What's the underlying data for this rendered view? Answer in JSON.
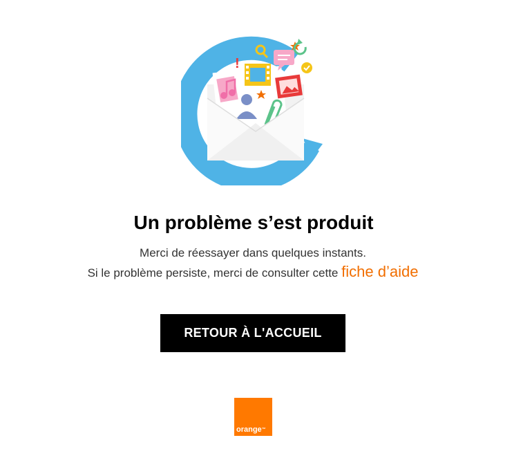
{
  "page": {
    "title": "Un problème s’est produit",
    "message_line1": "Merci de réessayer dans quelques instants.",
    "message_line2_prefix": "Si le problème persiste, merci de consulter cette ",
    "help_link_label": "fiche d’aide",
    "home_button_label": "RETOUR À L'ACCUEIL"
  },
  "logo": {
    "text": "orange",
    "trademark": "™"
  },
  "illustration": {
    "icons": [
      "envelope-icon",
      "music-note-icon",
      "film-icon",
      "search-icon",
      "chat-bubble-icon",
      "refresh-icon",
      "check-icon",
      "image-icon",
      "user-icon",
      "paperclip-icon",
      "star-icon",
      "exclamation-icon"
    ]
  },
  "colors": {
    "accent_orange": "#f16e00",
    "logo_orange": "#ff7900",
    "circle_blue": "#4fb3e6",
    "button_black": "#000000"
  }
}
